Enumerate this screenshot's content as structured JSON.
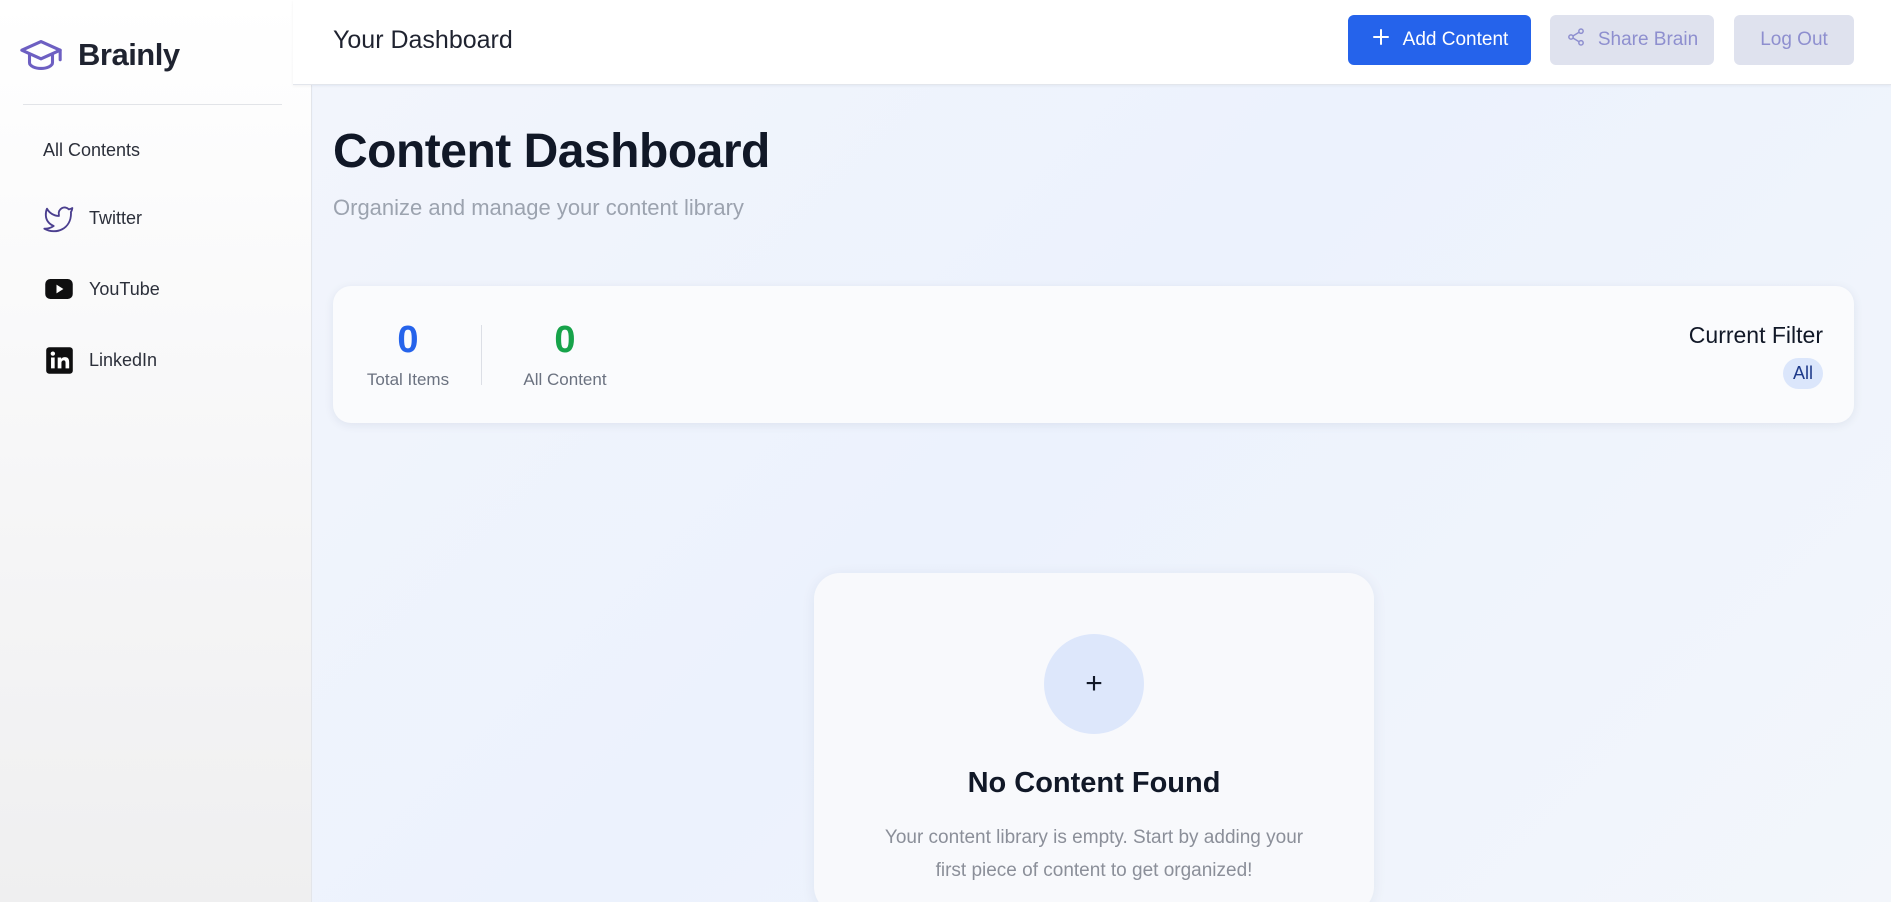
{
  "brand": {
    "name": "Brainly",
    "icon": "graduation-cap-icon",
    "accent": "#6d5fc2"
  },
  "sidebar": {
    "items": [
      {
        "label": "All Contents",
        "icon": ""
      },
      {
        "label": "Twitter",
        "icon": "twitter-icon"
      },
      {
        "label": "YouTube",
        "icon": "youtube-icon"
      },
      {
        "label": "LinkedIn",
        "icon": "linkedin-icon"
      }
    ]
  },
  "topbar": {
    "title": "Your Dashboard",
    "add_label": "Add Content",
    "share_label": "Share Brain",
    "logout_label": "Log Out",
    "primary_color": "#2563eb"
  },
  "main": {
    "title": "Content Dashboard",
    "subtitle": "Organize and manage your content library",
    "stats": [
      {
        "value": "0",
        "label": "Total Items",
        "color": "#2563eb"
      },
      {
        "value": "0",
        "label": "All Content",
        "color": "#16a34a"
      }
    ],
    "filter": {
      "title": "Current Filter",
      "value": "All"
    },
    "empty_state": {
      "icon": "+",
      "title": "No Content Found",
      "text": "Your content library is empty. Start by adding your first piece of content to get organized!"
    }
  }
}
